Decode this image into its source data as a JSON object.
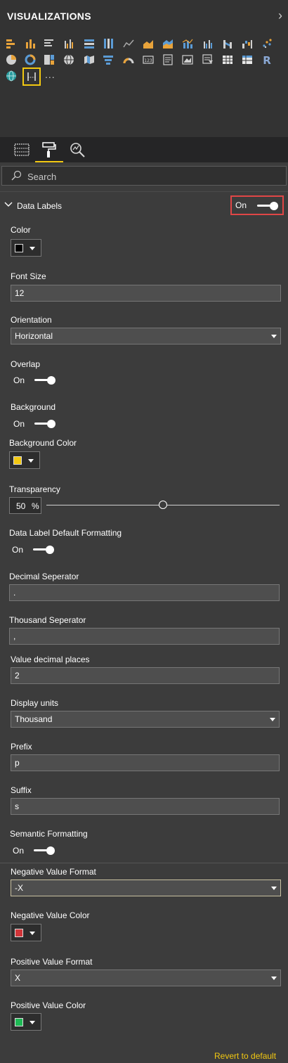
{
  "header": {
    "title": "VISUALIZATIONS",
    "collapse_icon": "chevron-right-icon"
  },
  "visuals": {
    "icons": [
      "stacked-bar-chart-icon",
      "stacked-column-chart-icon",
      "clustered-bar-chart-icon",
      "clustered-column-chart-icon",
      "100-stacked-bar-chart-icon",
      "100-stacked-column-chart-icon",
      "line-chart-icon",
      "area-chart-icon",
      "stacked-area-chart-icon",
      "line-and-stacked-column-chart-icon",
      "line-and-clustered-column-chart-icon",
      "ribbon-chart-icon",
      "waterfall-chart-icon",
      "scatter-chart-icon",
      "pie-chart-icon",
      "donut-chart-icon",
      "treemap-icon",
      "map-icon",
      "filled-map-icon",
      "funnel-icon",
      "gauge-icon",
      "card-icon",
      "multi-row-card-icon",
      "kpi-icon",
      "slicer-icon",
      "table-icon",
      "matrix-icon",
      "r-script-visual-icon",
      "globe-map-icon",
      "custom-visual-icon"
    ],
    "more_label": "...",
    "colors": {
      "bar": "#e8a33b",
      "blue": "#5b9bd5",
      "teal": "#2b9ea0",
      "gray": "#a8a8a8",
      "yellow": "#f2c811"
    }
  },
  "tabs": [
    {
      "name": "fields-tab",
      "icon": "fields-grid-icon"
    },
    {
      "name": "format-tab",
      "icon": "paint-roller-icon",
      "active": true
    },
    {
      "name": "analytics-tab",
      "icon": "analytics-magnifier-icon"
    }
  ],
  "search": {
    "placeholder": "Search",
    "icon": "search-icon"
  },
  "data_labels": {
    "title": "Data Labels",
    "toggle": "On",
    "color": {
      "label": "Color",
      "value": "#000000"
    },
    "font_size": {
      "label": "Font Size",
      "value": "12"
    },
    "orientation": {
      "label": "Orientation",
      "value": "Horizontal"
    },
    "overlap": {
      "label": "Overlap",
      "value": "On"
    },
    "background": {
      "label": "Background",
      "value": "On"
    },
    "background_color": {
      "label": "Background Color",
      "value": "#f2c811"
    },
    "transparency": {
      "label": "Transparency",
      "value": "50",
      "unit": "%",
      "percent": 50
    },
    "default_formatting": {
      "label": "Data Label Default Formatting",
      "value": "On"
    },
    "decimal_separator": {
      "label": "Decimal Seperator",
      "value": "."
    },
    "thousand_separator": {
      "label": "Thousand Seperator",
      "value": ","
    },
    "decimal_places": {
      "label": "Value decimal places",
      "value": "2"
    },
    "display_units": {
      "label": "Display units",
      "value": "Thousand"
    },
    "prefix": {
      "label": "Prefix",
      "value": "p"
    },
    "suffix": {
      "label": "Suffix",
      "value": "s"
    },
    "semantic_formatting": {
      "label": "Semantic Formatting",
      "value": "On"
    },
    "negative_format": {
      "label": "Negative Value Format",
      "value": "-X"
    },
    "negative_color": {
      "label": "Negative Value Color",
      "value": "#d13438"
    },
    "positive_format": {
      "label": "Positive Value Format",
      "value": "X"
    },
    "positive_color": {
      "label": "Positive Value Color",
      "value": "#1db954"
    }
  },
  "footer": {
    "revert_label": "Revert to default"
  }
}
